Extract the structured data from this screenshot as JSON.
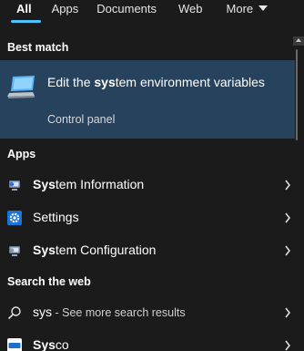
{
  "tabs": [
    {
      "label": "All",
      "active": true
    },
    {
      "label": "Apps"
    },
    {
      "label": "Documents"
    },
    {
      "label": "Web"
    },
    {
      "label": "More"
    }
  ],
  "sections": {
    "best_match": "Best match",
    "apps": "Apps",
    "web": "Search the web"
  },
  "best_match": {
    "title_pre": "Edit the ",
    "title_bold": "sys",
    "title_post": "tem environment variables",
    "subtitle": "Control panel",
    "icon": "computer-icon",
    "bg_color": "#26425d"
  },
  "apps": [
    {
      "bold": "Sys",
      "rest": "tem Information",
      "icon": "system-information-icon"
    },
    {
      "bold": "",
      "rest": "Settings",
      "icon": "settings-gear-icon"
    },
    {
      "bold": "Sys",
      "rest": "tem Configuration",
      "icon": "system-configuration-icon"
    }
  ],
  "web": [
    {
      "query": "sys",
      "suffix": " - See more search results",
      "icon": "search-icon"
    },
    {
      "bold": "Sys",
      "rest": "co",
      "icon": "sysco-logo-icon"
    }
  ],
  "colors": {
    "background": "#1b1b1b",
    "accent": "#4cc2ff",
    "selection": "#26425d"
  }
}
